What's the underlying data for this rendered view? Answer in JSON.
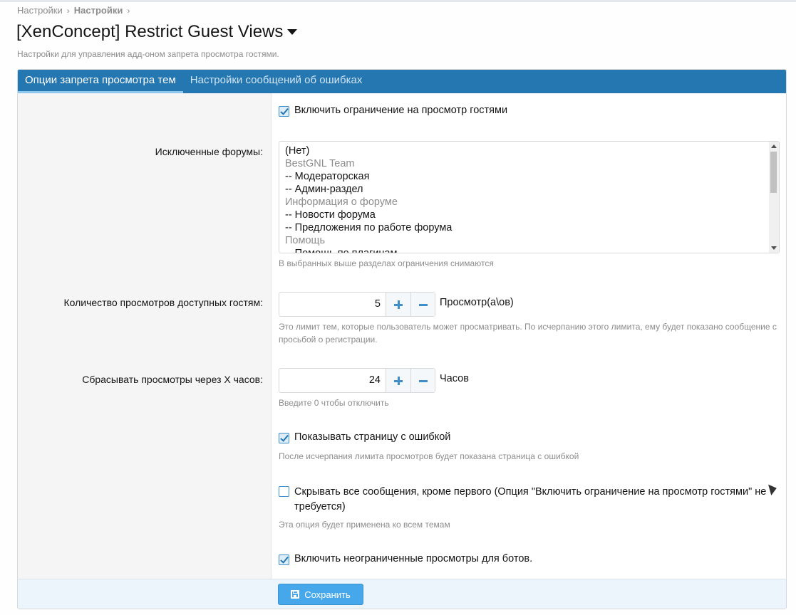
{
  "breadcrumb": {
    "items": [
      "Настройки",
      "Настройки"
    ],
    "separator": "›"
  },
  "page": {
    "title": "[XenConcept] Restrict Guest Views",
    "subtitle": "Настройки для управления адд-оном запрета просмотра гостями."
  },
  "tabs": [
    {
      "label": "Опции запрета просмотра тем",
      "active": true
    },
    {
      "label": "Настройки сообщений об ошибках",
      "active": false
    }
  ],
  "options": {
    "enable_restriction": {
      "label": "Включить ограничение на просмотр гостями",
      "checked": true
    },
    "excluded_forums": {
      "label": "Исключенные форумы:",
      "items": [
        {
          "text": "(Нет)",
          "group": false
        },
        {
          "text": "BestGNL Team",
          "group": true
        },
        {
          "text": "-- Модераторская",
          "group": false
        },
        {
          "text": "-- Админ-раздел",
          "group": false
        },
        {
          "text": "Информация о форуме",
          "group": true
        },
        {
          "text": "-- Новости форума",
          "group": false
        },
        {
          "text": "-- Предложения по работе форума",
          "group": false
        },
        {
          "text": "Помощь",
          "group": true
        },
        {
          "text": "-- Помощь по плагинам",
          "group": false
        }
      ],
      "hint": "В выбранных выше разделах ограничения снимаются"
    },
    "view_count": {
      "label": "Количество просмотров доступных гостям:",
      "value": "5",
      "unit": "Просмотр(а\\ов)",
      "hint": "Это лимит тем, которые пользователь может просматривать. По исчерпанию этого лимита, ему будет показано сообщение с просьбой о регистрации."
    },
    "reset_hours": {
      "label": "Сбрасывать просмотры через X часов:",
      "value": "24",
      "unit": "Часов",
      "hint": "Введите 0 чтобы отключить"
    },
    "show_error_page": {
      "label": "Показывать страницу с ошибкой",
      "checked": true,
      "hint": "После исчерпания лимита просмотров будет показана страница с ошибкой"
    },
    "hide_posts": {
      "label": "Скрывать все сообщения, кроме первого (Опция \"Включить ограничение на просмотр гостями\" не требуется)",
      "checked": false,
      "hint": "Эта опция будет применена ко всем темам"
    },
    "unlimited_bots": {
      "label": "Включить неограниченные просмотры для ботов.",
      "checked": true
    }
  },
  "footer": {
    "save_label": "Сохранить"
  },
  "colors": {
    "accent": "#2577b1",
    "button": "#47a7eb",
    "hint": "#8c8c8c"
  }
}
